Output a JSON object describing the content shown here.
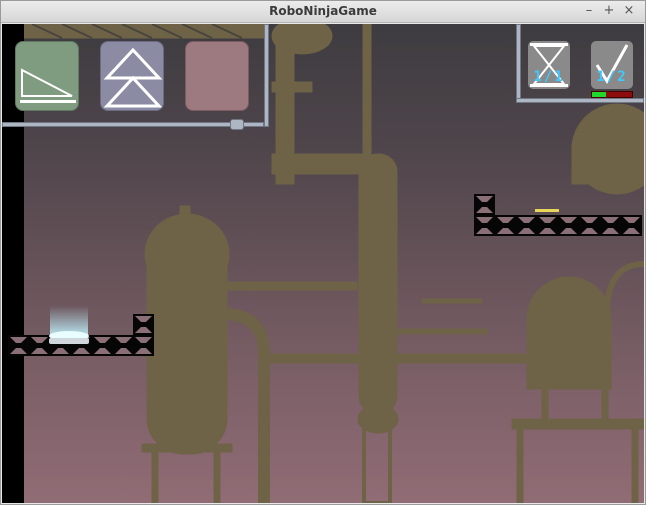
{
  "window": {
    "title": "RoboNinjaGame",
    "min_icon": "minimize-icon",
    "max_icon": "maximize-icon",
    "close_icon": "close-icon"
  },
  "hud": {
    "actions": [
      {
        "name": "slide",
        "icon": "ramp-slide-icon",
        "color": "#7f9b80"
      },
      {
        "name": "jump",
        "icon": "double-arrow-up-icon",
        "color": "#8b8ca4"
      },
      {
        "name": "empty",
        "icon": "",
        "color": "#9c7a80"
      }
    ],
    "timer_counter": {
      "icon": "hourglass-icon",
      "text": "1/1"
    },
    "goal_counter": {
      "icon": "checkmark-icon",
      "text": "1/2"
    },
    "health": 0.35
  },
  "colors": {
    "silhouette": "#6e6247",
    "block": "#060606",
    "block_mark": "#8a7076",
    "sky_top": "#3e3c40",
    "sky_bottom": "#916c75",
    "goal": "#e8d55a",
    "spawn_glow": "#bff4ff"
  }
}
